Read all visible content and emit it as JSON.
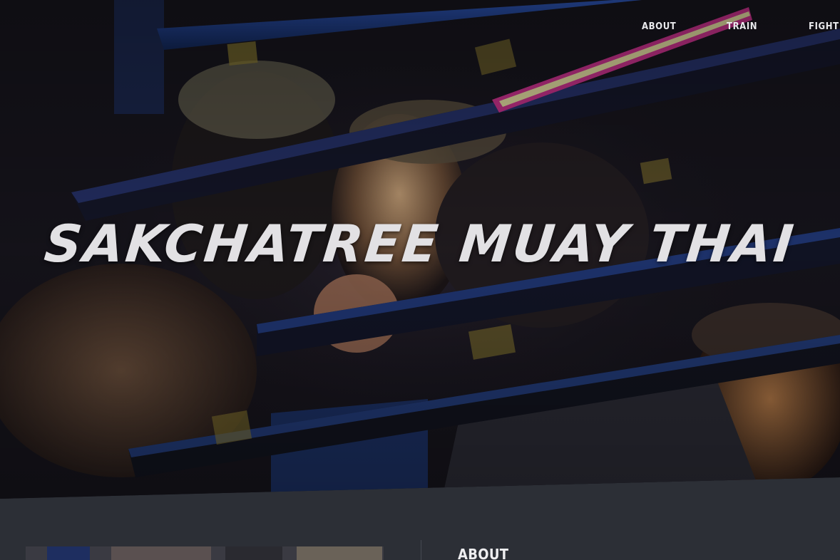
{
  "nav": {
    "items": [
      {
        "label": "ABOUT"
      },
      {
        "label": "TRAIN"
      },
      {
        "label": "FIGHT"
      }
    ]
  },
  "hero": {
    "title": "SAKCHATREE MUAY THAI",
    "image": "muay-thai-ringside-photo"
  },
  "about": {
    "heading": "ABOUT",
    "image": "gym-photo"
  },
  "colors": {
    "background": "#2c2f36",
    "hero_dark": "#16141c",
    "rope_blue": "#1f3f8f",
    "rope_magenta": "#c8328c",
    "text": "#e2e1e4"
  }
}
